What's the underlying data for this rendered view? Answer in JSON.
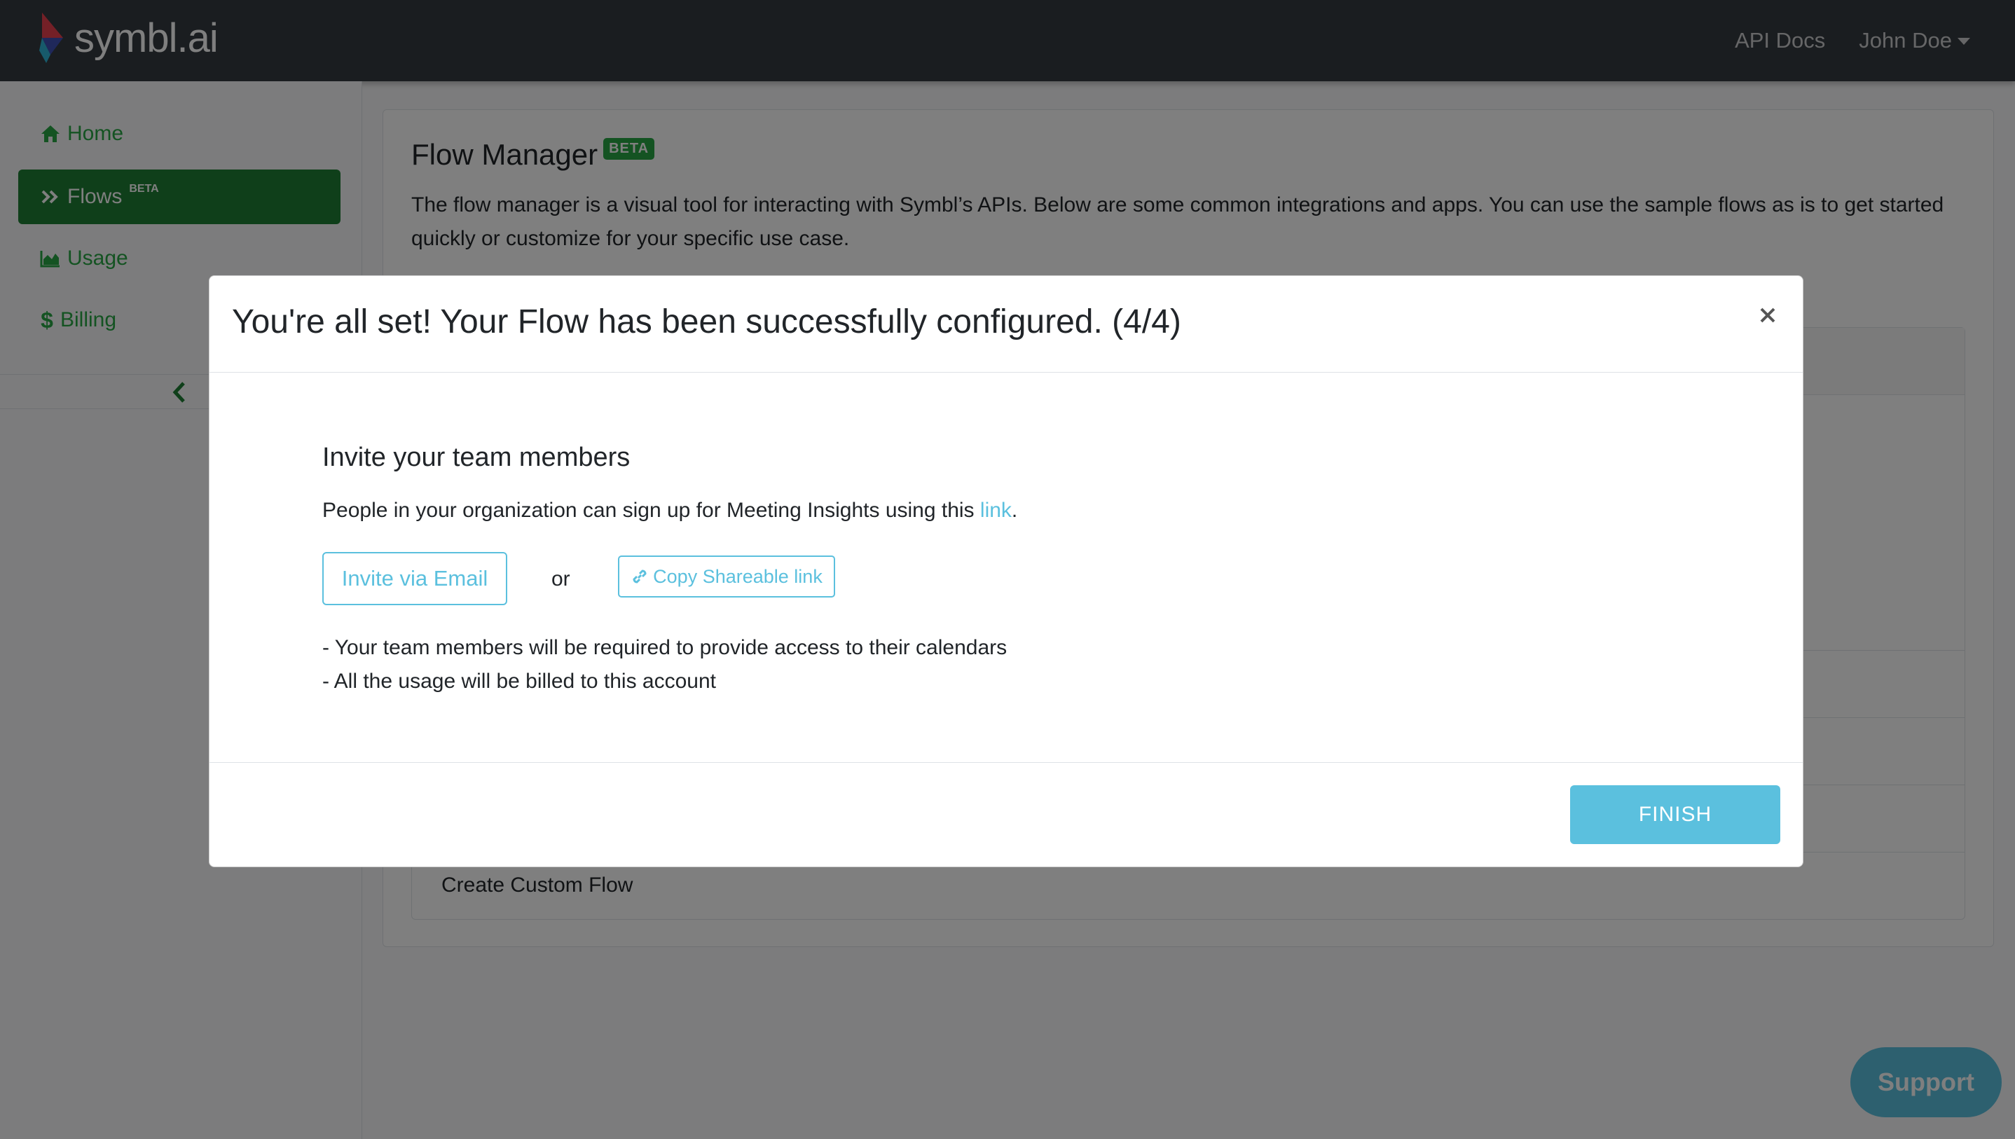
{
  "brand": {
    "name": "symbl.ai"
  },
  "topnav": {
    "api_docs": "API Docs",
    "user": "John Doe"
  },
  "sidebar": {
    "items": [
      {
        "label": "Home",
        "icon": "home-icon"
      },
      {
        "label": "Flows",
        "icon": "double-chevron-right-icon",
        "badge": "BETA",
        "active": true
      },
      {
        "label": "Usage",
        "icon": "area-chart-icon"
      },
      {
        "label": "Billing",
        "icon": "dollar-icon"
      }
    ],
    "collapse_icon": "chevron-left-icon"
  },
  "main": {
    "title": "Flow Manager",
    "badge": "BETA",
    "description": "The flow manager is a visual tool for interacting with Symbl’s APIs. Below are some common integrations and apps. You can use the sample flows as is to get started quickly or customize for your specific use case.",
    "flows": [
      {
        "label": "Create Custom Flow"
      }
    ]
  },
  "modal": {
    "title": "You're all set! Your Flow has been successfully configured. (4/4)",
    "close_label": "×",
    "invite_heading": "Invite your team members",
    "invite_text_before": "People in your organization can sign up for Meeting Insights using this ",
    "invite_link": "link",
    "invite_text_after": ".",
    "invite_email_button": "Invite via Email",
    "or_text": "or",
    "copy_link_button": "Copy Shareable link",
    "notes": [
      "- Your team members will be required to provide access to their calendars",
      "- All the usage will be billed to this account"
    ],
    "finish_button": "FINISH"
  },
  "support": {
    "label": "Support"
  },
  "colors": {
    "accent": "#5bc0de",
    "success": "#28a745",
    "success_dark": "#1e7e34",
    "navbar": "#343a40"
  }
}
